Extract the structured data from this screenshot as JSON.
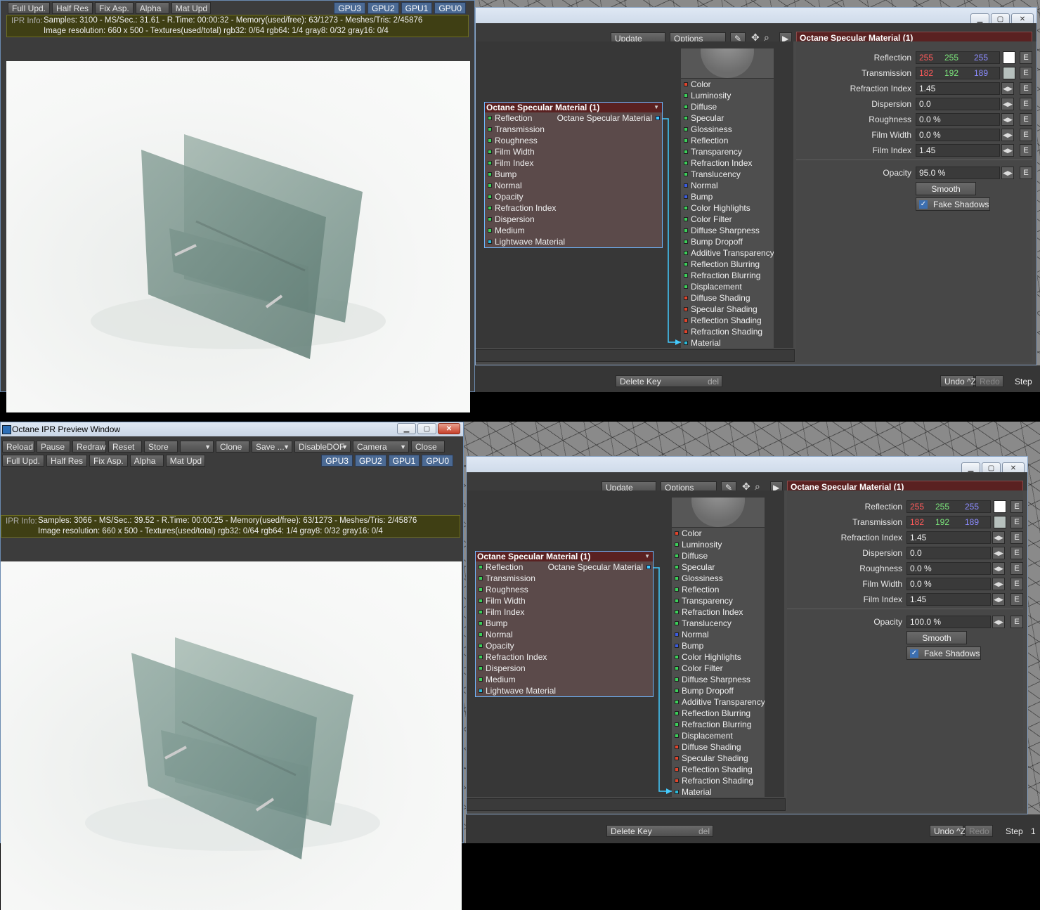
{
  "ipr": {
    "title": "Octane IPR Preview Window",
    "toolbar1": [
      "Reload",
      "Pause",
      "Redraw",
      "Reset",
      "Store",
      "",
      "Clone",
      "Save ...",
      "DisableDOF",
      "Camera",
      "Close"
    ],
    "toolbar2": [
      "Full Upd.",
      "Half Res",
      "Fix Asp.",
      "Alpha",
      "Mat Upd"
    ],
    "gpus": [
      "GPU3",
      "GPU2",
      "GPU1",
      "GPU0"
    ],
    "info_label": "IPR Info:",
    "top": {
      "line1": "Samples: 3100  -  MS/Sec.: 31.61  -  R.Time: 00:00:32 - Memory(used/free): 63/1273  -  Meshes/Tris: 2/45876",
      "line2": "Image resolution: 660 x 500 - Textures(used/total) rgb32: 0/64   rgb64: 1/4   gray8: 0/32   gray16: 0/4"
    },
    "bottom": {
      "line1": "Samples: 3066  -  MS/Sec.: 39.52  -  R.Time: 00:00:25 - Memory(used/free): 63/1273  -  Meshes/Tris: 2/45876",
      "line2": "Image resolution: 660 x 500 - Textures(used/total) rgb32: 0/64   rgb64: 1/4   gray8: 0/32   gray16: 0/4"
    }
  },
  "editor": {
    "update": "Update",
    "options": "Options",
    "material_title": "Octane Specular Material (1)",
    "node_output": "Octane Specular Material",
    "node_inputs": [
      "Reflection",
      "Transmission",
      "Roughness",
      "Film Width",
      "Film Index",
      "Bump",
      "Normal",
      "Opacity",
      "Refraction Index",
      "Dispersion",
      "Medium",
      "Lightwave Material"
    ],
    "surface_inputs": [
      {
        "label": "Color",
        "c": "dr"
      },
      {
        "label": "Luminosity",
        "c": "dg"
      },
      {
        "label": "Diffuse",
        "c": "dg"
      },
      {
        "label": "Specular",
        "c": "dg"
      },
      {
        "label": "Glossiness",
        "c": "dg"
      },
      {
        "label": "Reflection",
        "c": "dg"
      },
      {
        "label": "Transparency",
        "c": "dg"
      },
      {
        "label": "Refraction Index",
        "c": "dg"
      },
      {
        "label": "Translucency",
        "c": "dg"
      },
      {
        "label": "Normal",
        "c": "db"
      },
      {
        "label": "Bump",
        "c": "db"
      },
      {
        "label": "Color Highlights",
        "c": "dg"
      },
      {
        "label": "Color Filter",
        "c": "dg"
      },
      {
        "label": "Diffuse Sharpness",
        "c": "dg"
      },
      {
        "label": "Bump Dropoff",
        "c": "dg"
      },
      {
        "label": "Additive Transparency",
        "c": "dg"
      },
      {
        "label": "Reflection Blurring",
        "c": "dg"
      },
      {
        "label": "Refraction Blurring",
        "c": "dg"
      },
      {
        "label": "Displacement",
        "c": "dg"
      },
      {
        "label": "Diffuse Shading",
        "c": "dr"
      },
      {
        "label": "Specular Shading",
        "c": "dr"
      },
      {
        "label": "Reflection Shading",
        "c": "dr"
      },
      {
        "label": "Refraction Shading",
        "c": "dr"
      },
      {
        "label": "Material",
        "c": "dc"
      }
    ],
    "props": {
      "reflection": {
        "label": "Reflection",
        "r": "255",
        "g": "255",
        "b": "255",
        "swatch": "#ffffff"
      },
      "transmission": {
        "label": "Transmission",
        "r": "182",
        "g": "192",
        "b": "189",
        "swatch": "#b6c0bd"
      },
      "refraction_index": {
        "label": "Refraction Index",
        "value": "1.45"
      },
      "dispersion": {
        "label": "Dispersion",
        "value": "0.0"
      },
      "roughness": {
        "label": "Roughness",
        "value": "0.0 %"
      },
      "film_width": {
        "label": "Film Width",
        "value": "0.0 %"
      },
      "film_index": {
        "label": "Film Index",
        "value": "1.45"
      },
      "opacity_label": "Opacity",
      "opacity_top": "95.0 %",
      "opacity_bottom": "100.0 %",
      "smooth": "Smooth",
      "fake_shadows": "Fake Shadows",
      "e": "E"
    },
    "lw": {
      "delete_key": "Delete Key",
      "del": "del",
      "undo": "Undo",
      "undo_key": "^Z",
      "redo": "Redo",
      "step": "Step",
      "step_val": "1"
    }
  },
  "colors": {
    "red": "#ff5a5a",
    "green": "#7be37b",
    "blue": "#8c8cff",
    "node_title": "#5a2121",
    "accent": "#6fb6ff"
  }
}
